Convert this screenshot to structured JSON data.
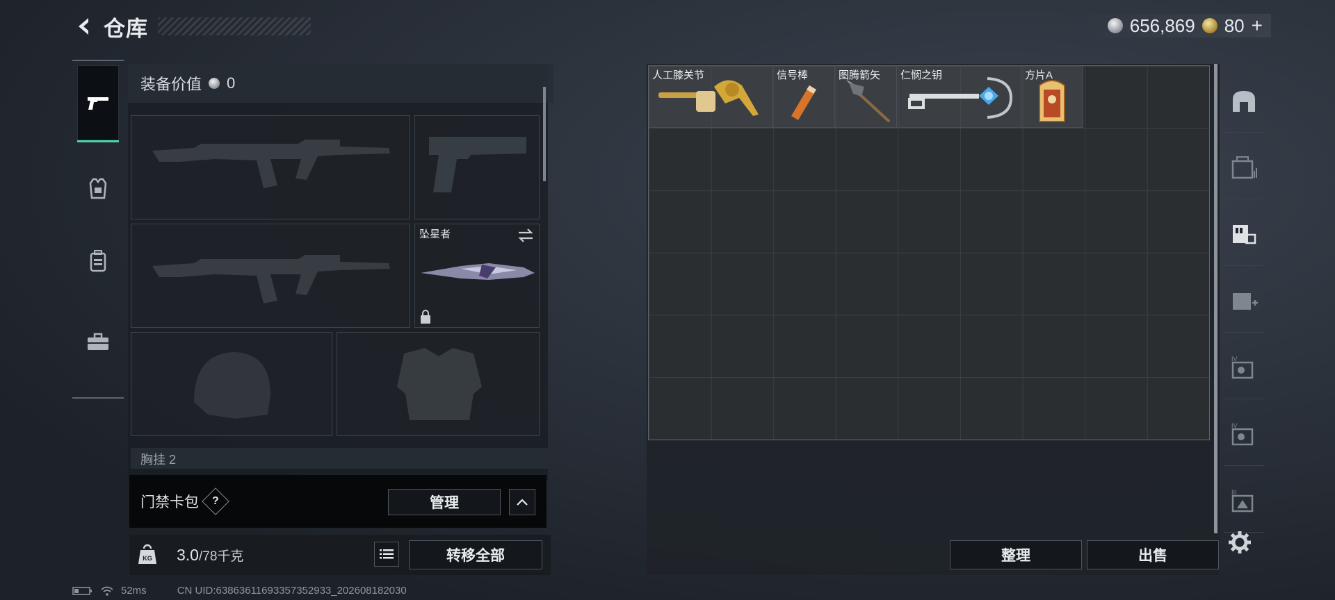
{
  "header": {
    "title": "仓库"
  },
  "currency": {
    "silver": "656,869",
    "gold": "80",
    "plus": "+"
  },
  "loadout": {
    "value_label": "装备价值",
    "value": "0",
    "melee_name": "坠星者",
    "chest_label": "胸挂 2"
  },
  "card_pack": {
    "label": "门禁卡包",
    "help": "?",
    "manage": "管理"
  },
  "weight": {
    "current": "3.0",
    "max": "/78千克",
    "kg_badge": "KG",
    "transfer_all": "转移全部"
  },
  "status_bar": {
    "ping": "52ms",
    "uid": "CN UID:6386361169335735293​3_202608182030"
  },
  "stash": {
    "items": [
      {
        "name": "人工膝关节"
      },
      {
        "name": "信号棒"
      },
      {
        "name": "图腾箭矢"
      },
      {
        "name": "仁悯之钥"
      },
      {
        "name": "方片A"
      }
    ],
    "tidy": "整理",
    "sell": "出售"
  },
  "right_nav": [
    {
      "icon": "stash-arch-icon"
    },
    {
      "icon": "locker-icon"
    },
    {
      "icon": "collectibles-icon"
    },
    {
      "icon": "medical-case-icon"
    },
    {
      "icon": "level-iv-case-icon"
    },
    {
      "icon": "level-iv-case-2-icon"
    },
    {
      "icon": "level-iii-case-icon"
    }
  ],
  "colors": {
    "accent": "#4ed4b0",
    "panel": "#1f2329",
    "grid_line": "#3b4042"
  }
}
